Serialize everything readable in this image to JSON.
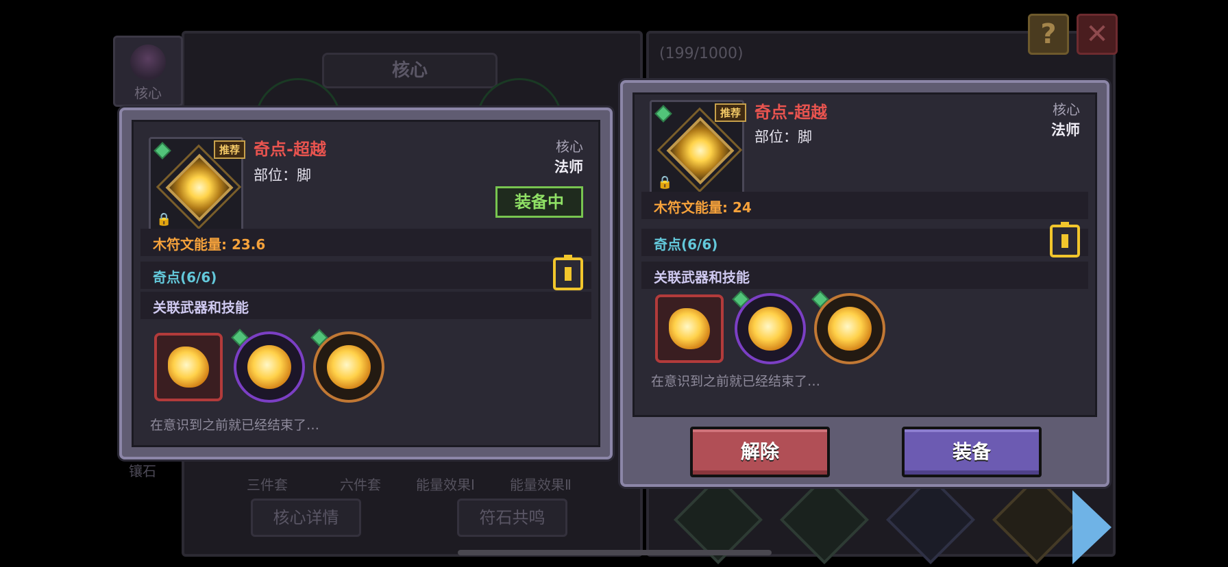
{
  "background": {
    "core_tab_label": "核心",
    "panel_title": "核心",
    "counter": "(199/1000)",
    "side_text": "镶石",
    "set_labels": [
      "三件套",
      "六件套",
      "能量效果Ⅰ",
      "能量效果Ⅱ"
    ],
    "core_detail_button": "核心详情",
    "rune_resonance_button": "符石共鸣"
  },
  "controls": {
    "help_symbol": "?",
    "close_symbol": "✕"
  },
  "left_card": {
    "recommend_badge": "推荐",
    "item_name": "奇点-超越",
    "slot": "部位：脚",
    "category": "核心",
    "class": "法师",
    "equipped_label": "装备中",
    "energy": "木符文能量: 23.6",
    "singularity": "奇点(6/6)",
    "related": "关联武器和技能",
    "flavor": "在意识到之前就已经结束了…"
  },
  "right_card": {
    "recommend_badge": "推荐",
    "item_name": "奇点-超越",
    "slot": "部位：脚",
    "category": "核心",
    "class": "法师",
    "energy": "木符文能量: 24",
    "singularity": "奇点(6/6)",
    "related": "关联武器和技能",
    "flavor": "在意识到之前就已经结束了…",
    "remove_button": "解除",
    "equip_button": "装备"
  },
  "colors": {
    "item_name": "#e9544f",
    "energy": "#f6a23b",
    "singularity": "#63c8da",
    "equipped": "#8fe065"
  }
}
